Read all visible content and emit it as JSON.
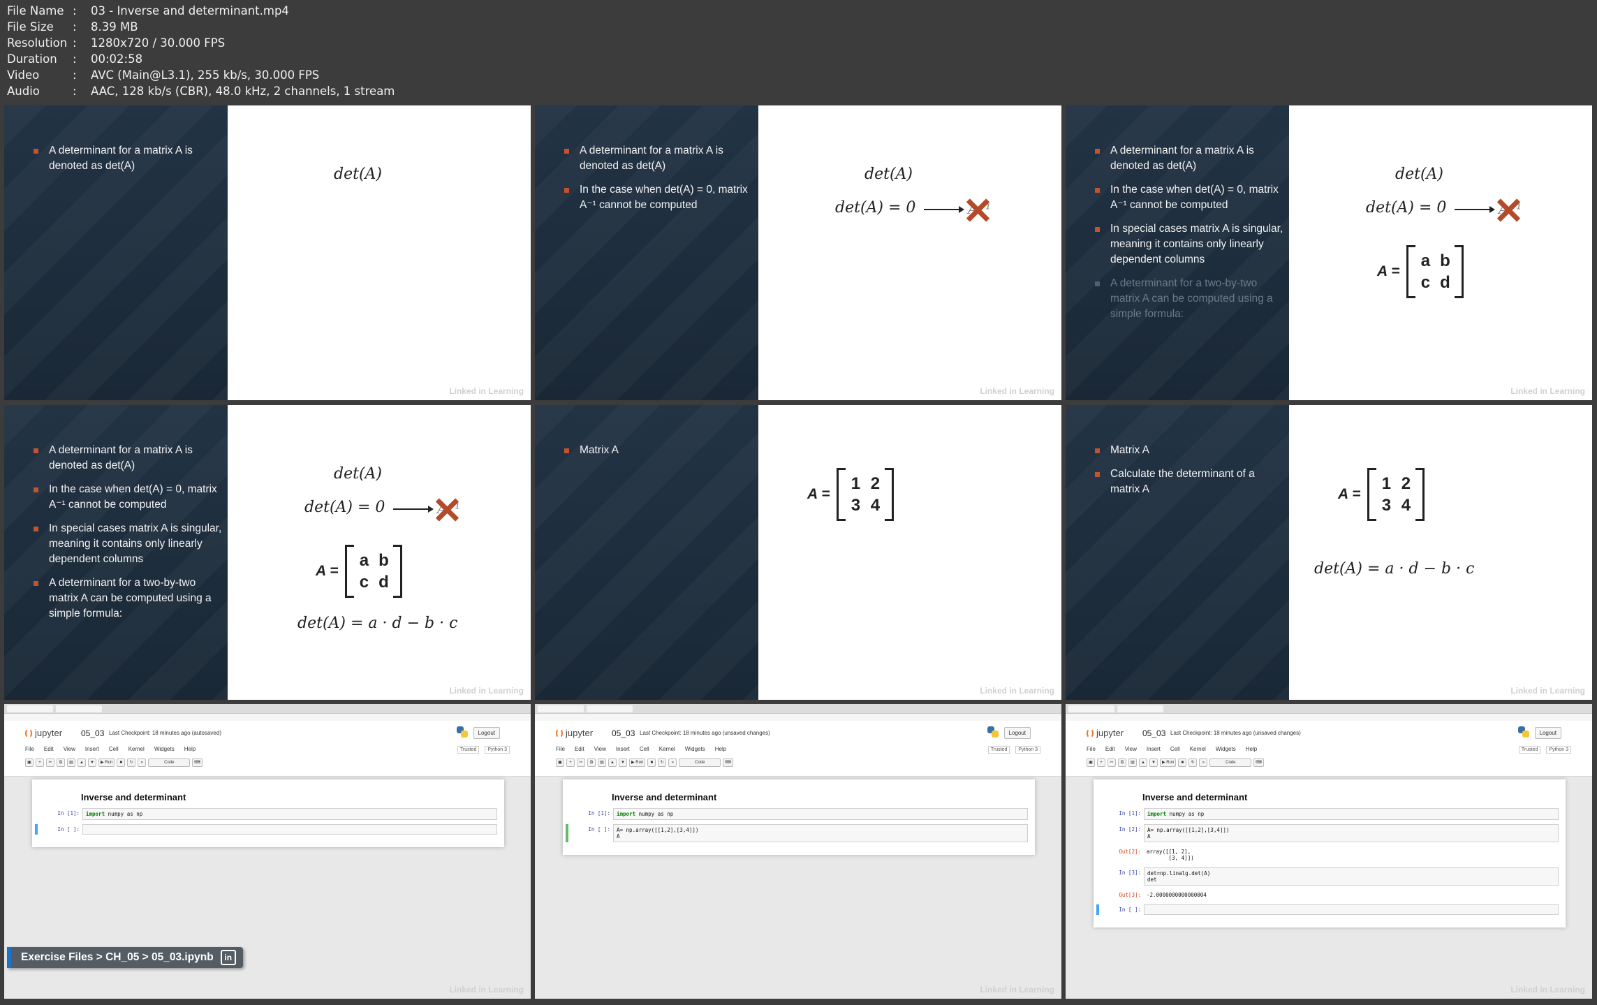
{
  "meta": {
    "rows": [
      {
        "key": "File Name",
        "value": "03 - Inverse and determinant.mp4"
      },
      {
        "key": "File Size",
        "value": "8.39 MB"
      },
      {
        "key": "Resolution",
        "value": "1280x720 / 30.000 FPS"
      },
      {
        "key": "Duration",
        "value": "00:02:58"
      },
      {
        "key": "Video",
        "value": "AVC (Main@L3.1), 255 kb/s, 30.000 FPS"
      },
      {
        "key": "Audio",
        "value": "AAC, 128 kb/s (CBR), 48.0 kHz, 2 channels, 1 stream"
      }
    ]
  },
  "slides": {
    "b_det": "A determinant for a matrix A is denoted as det(A)",
    "b_zero": "In the case when det(A) = 0, matrix A⁻¹ cannot be computed",
    "b_singular": "In special cases matrix A is singular, meaning it contains only linearly dependent columns",
    "b_formula": "A determinant for a two-by-two matrix A can be computed using a simple formula:",
    "b_matrixA": "Matrix A",
    "b_calc": "Calculate the determinant of a matrix A",
    "m_det": "det(A)",
    "m_det0": "det(A) = 0",
    "m_ainv": "A⁻¹",
    "m_formula": "det(A) = a · d − b · c",
    "m_lhs": "A =",
    "sym": {
      "a": "a",
      "b": "b",
      "c": "c",
      "d": "d"
    },
    "num": {
      "n1": "1",
      "n2": "2",
      "n3": "3",
      "n4": "4"
    },
    "watermark": "Linked in Learning"
  },
  "jupyter": {
    "brand": "jupyter",
    "nbname": "05_03",
    "checkpoint_autosaved": "Last Checkpoint: 18 minutes ago  (autosaved)",
    "checkpoint_unsaved": "Last Checkpoint: 18 minutes ago  (unsaved changes)",
    "logout": "Logout",
    "menu": [
      "File",
      "Edit",
      "View",
      "Insert",
      "Cell",
      "Kernel",
      "Widgets",
      "Help"
    ],
    "trusted": "Trusted",
    "kernel": "Python 3",
    "run": "Run",
    "celltype": "Code",
    "heading": "Inverse and determinant",
    "p_in1": "In [1]:",
    "p_in_empty": "In [ ]:",
    "p_in2": "In [2]:",
    "p_out2": "Out[2]:",
    "p_in3": "In [3]:",
    "p_out3": "Out[3]:",
    "code_import_kw": "import",
    "code_import_rest": " numpy as np",
    "code_array": "A= np.array([[1,2],[3,4]])\nA",
    "out_array": "array([[1, 2],\n       [3, 4]])",
    "code_det": "det=np.linalg.det(A)\ndet",
    "out_det": "-2.0000000000000004",
    "crumb": "Exercise Files > CH_05 > 05_03.ipynb",
    "li": "in"
  }
}
